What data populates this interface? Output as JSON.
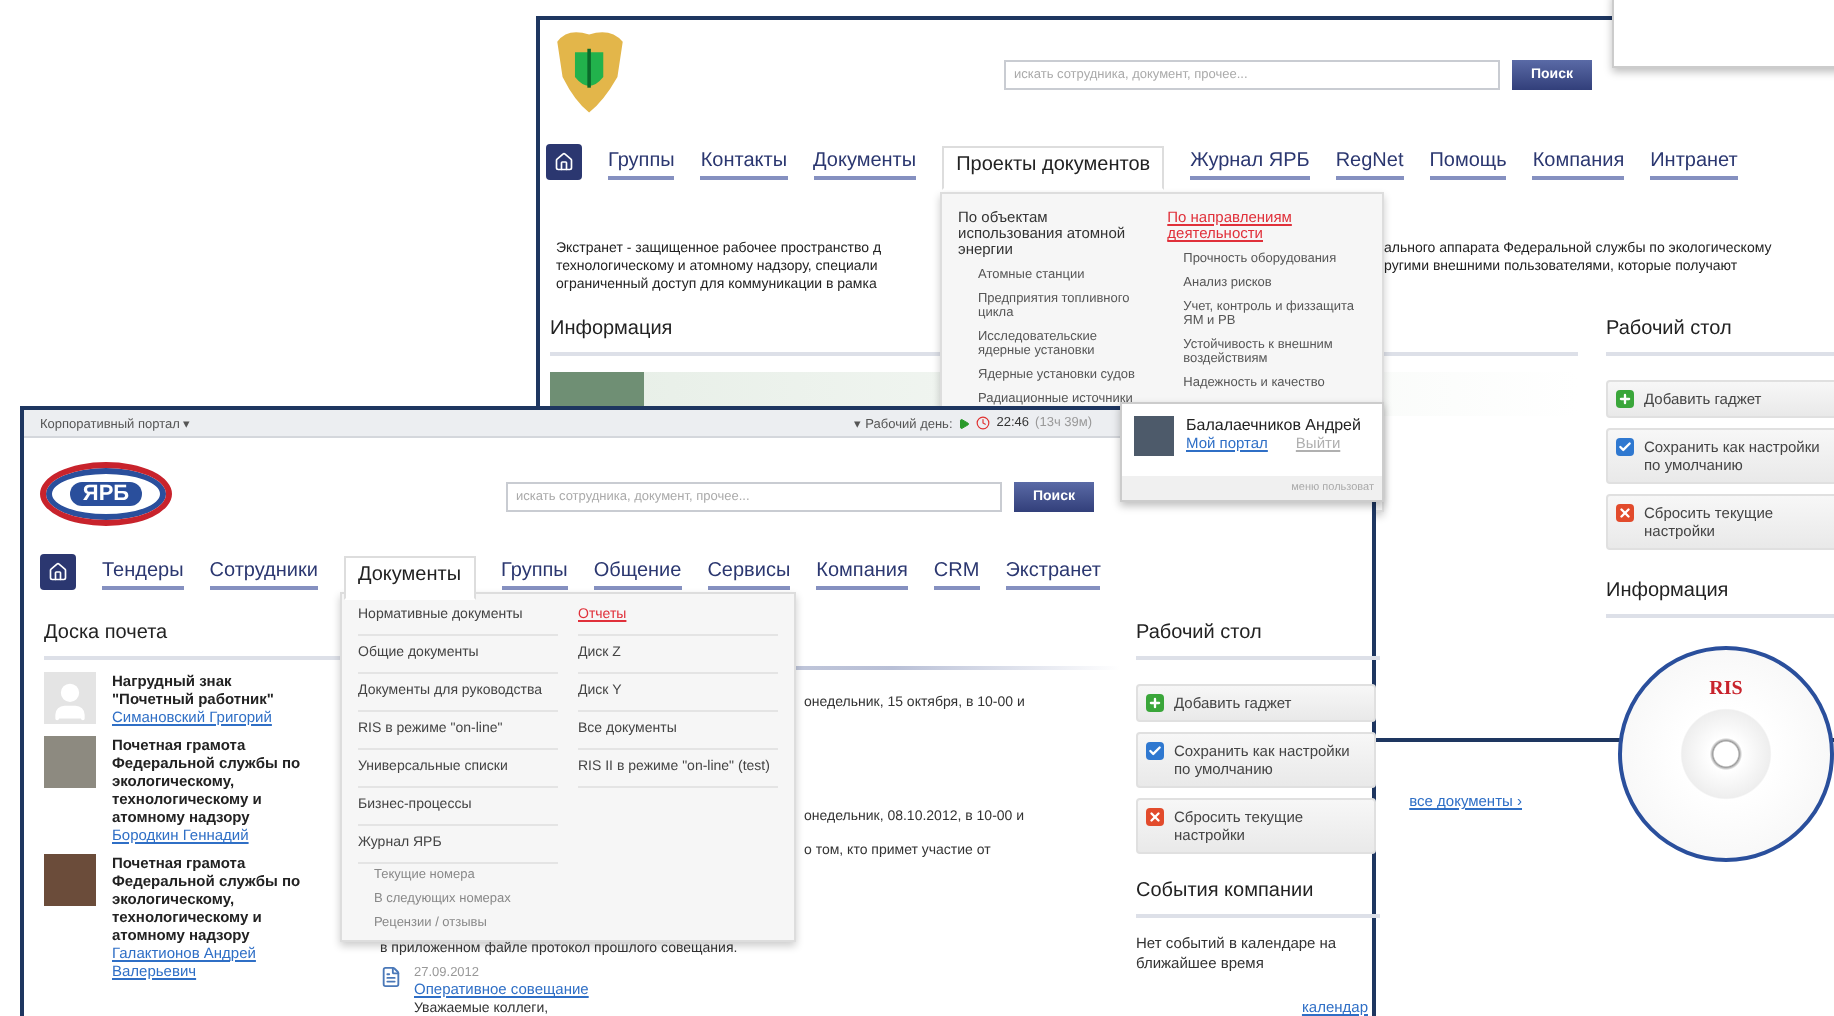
{
  "back_window": {
    "search": {
      "placeholder": "искать сотрудника, документ, прочее...",
      "button": "Поиск"
    },
    "nav": [
      {
        "label": "Группы",
        "selected": false
      },
      {
        "label": "Контакты",
        "selected": false
      },
      {
        "label": "Документы",
        "selected": false
      },
      {
        "label": "Проекты документов",
        "selected": true
      },
      {
        "label": "Журнал ЯРБ",
        "selected": false
      },
      {
        "label": "RegNet",
        "selected": false
      },
      {
        "label": "Помощь",
        "selected": false
      },
      {
        "label": "Компания",
        "selected": false
      },
      {
        "label": "Интранет",
        "selected": false
      }
    ],
    "dropdown": [
      {
        "heading": "По объектам использования атомной энергии",
        "selected": false,
        "items": [
          "Атомные станции",
          "Предприятия топливного цикла",
          "Исследовательские ядерные установки",
          "Ядерные установки судов",
          "Радиационные источники"
        ]
      },
      {
        "heading": "По направлениям деятельности",
        "selected": true,
        "items": [
          "Прочность оборудования",
          "Анализ рисков",
          "Учет, контроль и физзащита ЯМ и РВ",
          "Устойчивость к внешним воздействиям",
          "Надежность и качество"
        ]
      }
    ],
    "intro_left": [
      "Экстранет - защищенное рабочее пространство д",
      "технологическому и атомному надзору, специали",
      "ограниченный доступ для коммуникации  в рамка"
    ],
    "intro_right": [
      "ального аппарата Федеральной службы по экологическому",
      "ругими внешними пользователями, которые получают"
    ],
    "info_heading": "Информация",
    "all_docs": "все документы ›",
    "desk_heading": "Рабочий стол",
    "gadgets": [
      {
        "kind": "add",
        "label": "Добавить гаджет"
      },
      {
        "kind": "save",
        "label": "Сохранить как настройки по умолчанию"
      },
      {
        "kind": "reset",
        "label": "Сбросить текущие настройки"
      }
    ],
    "info_heading_2": "Информация",
    "disc_label": "RIS"
  },
  "front_window": {
    "top_bar": {
      "portal": "Корпоративный портал ▾",
      "workday": "▾ Рабочий день:",
      "time": "22:46",
      "duration": "(13ч 39м)"
    },
    "logo_text": "ЯРБ",
    "search": {
      "placeholder": "искать сотрудника, документ, прочее...",
      "button": "Поиск"
    },
    "nav": [
      {
        "label": "Тендеры",
        "selected": false
      },
      {
        "label": "Сотрудники",
        "selected": false
      },
      {
        "label": "Документы",
        "selected": true
      },
      {
        "label": "Группы",
        "selected": false
      },
      {
        "label": "Общение",
        "selected": false
      },
      {
        "label": "Сервисы",
        "selected": false
      },
      {
        "label": "Компания",
        "selected": false
      },
      {
        "label": "CRM",
        "selected": false
      },
      {
        "label": "Экстранет",
        "selected": false
      }
    ],
    "dropdown": [
      {
        "items": [
          {
            "label": "Нормативные документы",
            "selected": false
          },
          {
            "label": "Общие документы",
            "selected": false
          },
          {
            "label": "Документы для руководства",
            "selected": false
          },
          {
            "label": "RIS в режиме \"on-line\"",
            "selected": false
          },
          {
            "label": "Универсальные списки",
            "selected": false
          },
          {
            "label": "Бизнес-процессы",
            "selected": false
          },
          {
            "label": "Журнал ЯРБ",
            "selected": false,
            "children": [
              "Текущие номера",
              "В следующих номерах",
              "Рецензии / отзывы"
            ]
          }
        ]
      },
      {
        "items": [
          {
            "label": "Отчеты",
            "selected": true
          },
          {
            "label": "Диск Z",
            "selected": false
          },
          {
            "label": "Диск Y",
            "selected": false
          },
          {
            "label": "Все документы",
            "selected": false
          },
          {
            "label": "RIS II в режиме \"on-line\" (test)",
            "selected": false
          }
        ]
      }
    ],
    "honor_heading": "Доска почета",
    "honors": [
      {
        "kind": "placeholder",
        "award": "Нагрудный знак \"Почетный работник\"",
        "person": "Симановский Григорий"
      },
      {
        "kind": "photo",
        "award": "Почетная грамота Федеральной службы по экологическому, технологическому и атомному надзору",
        "person": "Бородкин Геннадий"
      },
      {
        "kind": "photo",
        "award": "Почетная грамота Федеральной службы по экологическому, технологическому и атомному надзору",
        "person": "Галактионов Андрей Валерьевич"
      }
    ],
    "news_fragments": [
      "онедельник, 15 октября, в 10-00 и",
      "онедельник, 08.10.2012, в 10-00 и",
      "о том, кто примет участие от",
      "в приложенном файле протокол прошлого совещания."
    ],
    "news_item": {
      "date": "27.09.2012",
      "title": "Оперативное совещание",
      "text": "Уважаемые коллеги,"
    },
    "desk_heading": "Рабочий стол",
    "gadgets": [
      {
        "kind": "add",
        "label": "Добавить гаджет"
      },
      {
        "kind": "save",
        "label": "Сохранить как настройки по умолчанию"
      },
      {
        "kind": "reset",
        "label": "Сбросить текущие настройки"
      }
    ],
    "events_heading": "События компании",
    "events_text": "Нет событий в календаре на ближайшее время",
    "calendar_link": "календар",
    "user": {
      "name": "Балалаечников Андрей",
      "portal_link": "Мой портал",
      "logout": {
        "label": "Выйти",
        "disabled": true
      },
      "menu_label": "меню пользоват"
    }
  }
}
